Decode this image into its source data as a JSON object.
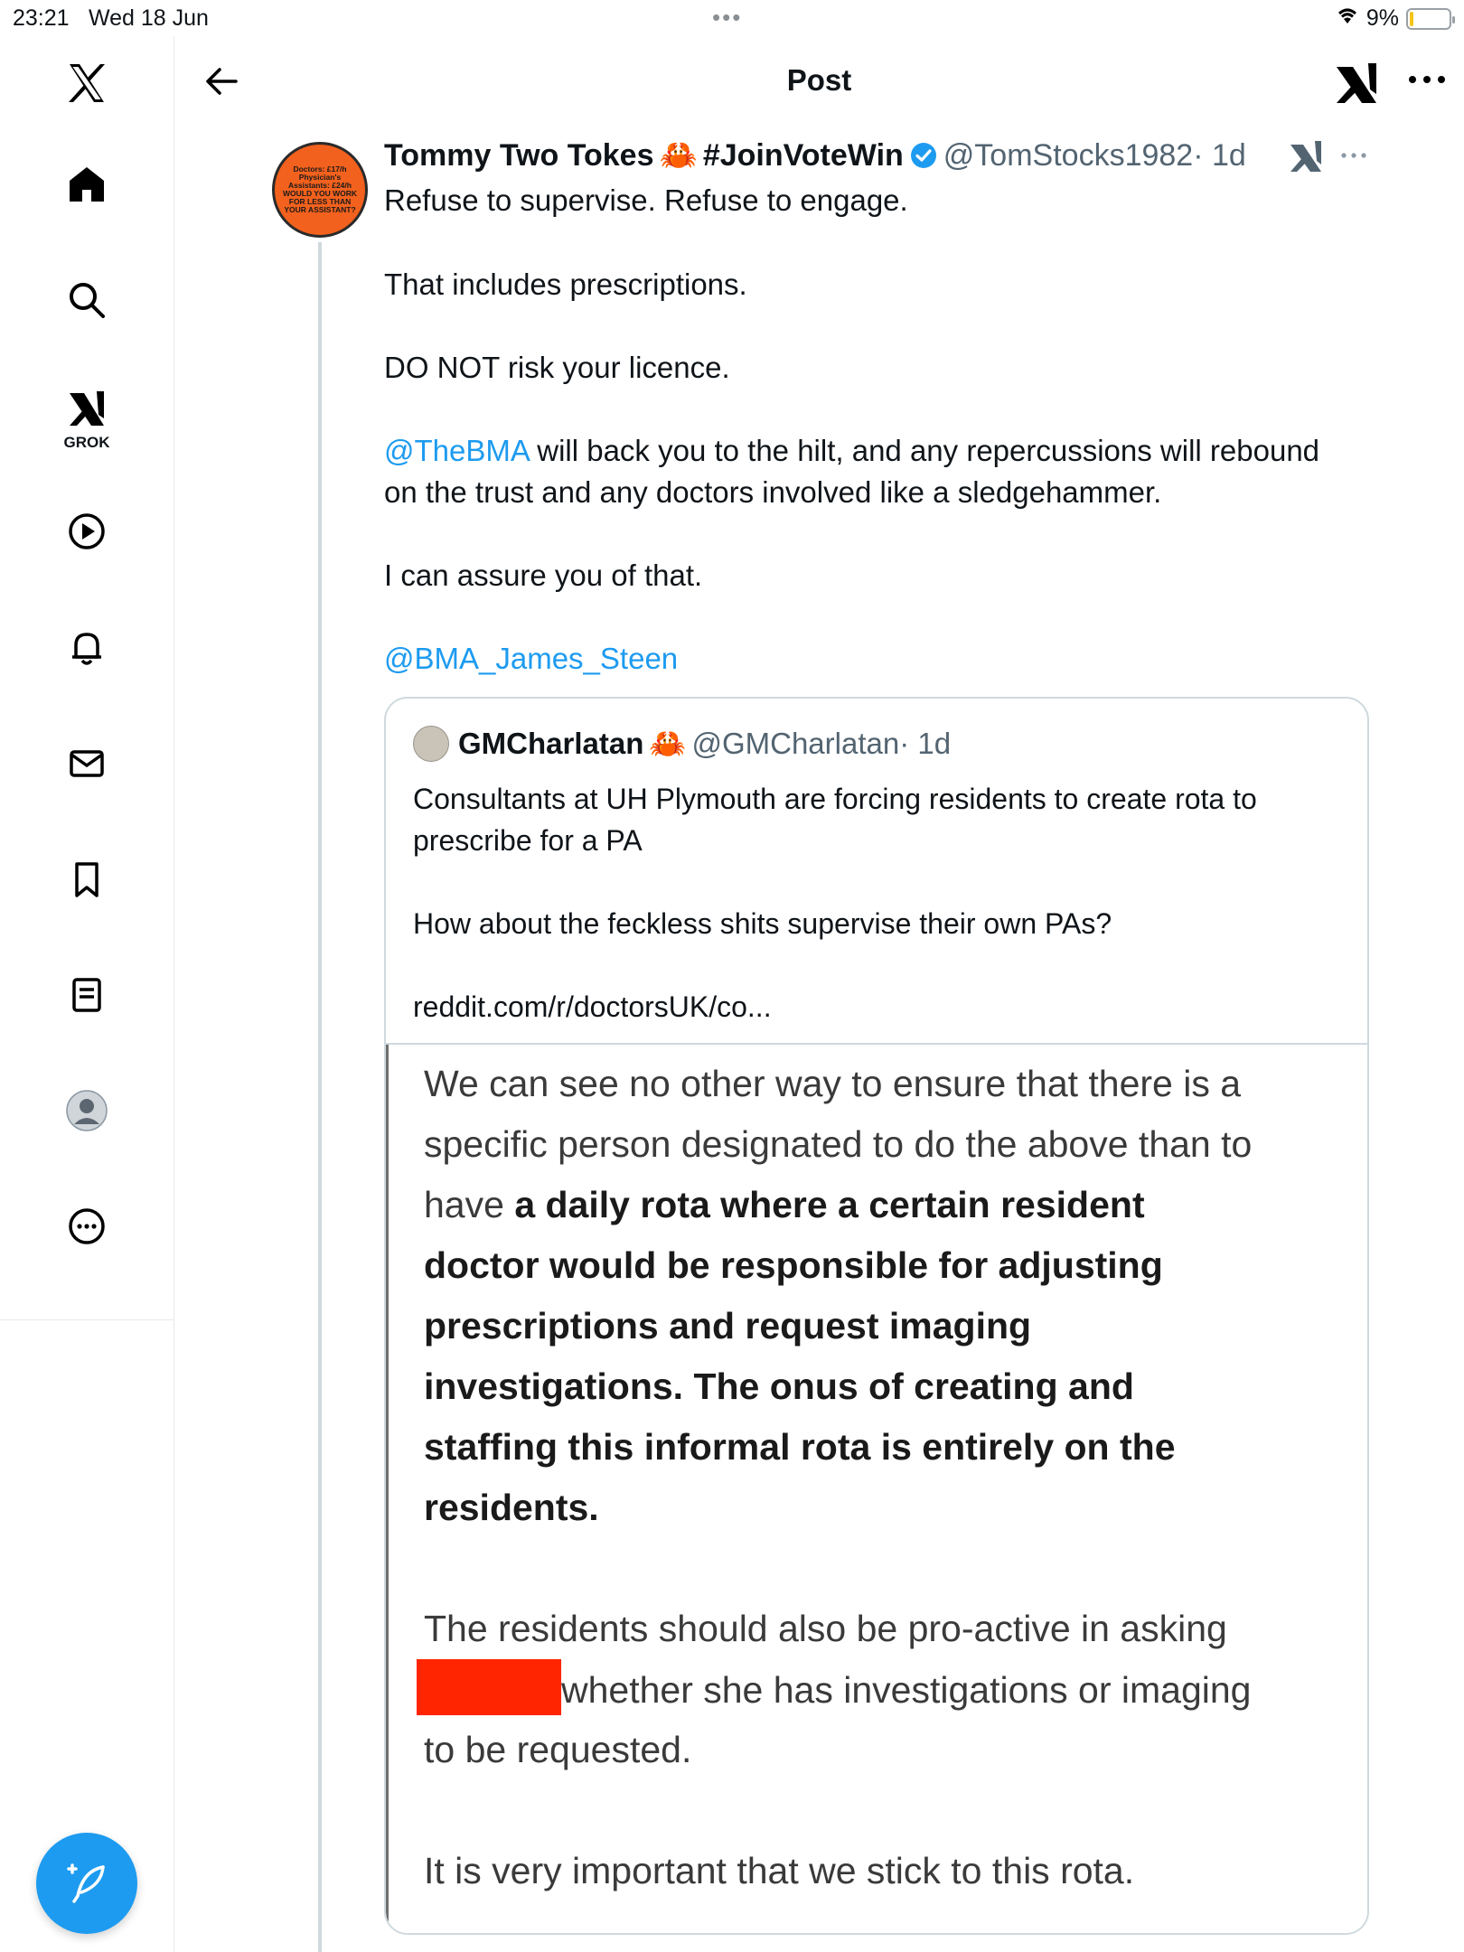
{
  "status_bar": {
    "time": "23:21",
    "date": "Wed 18 Jun",
    "battery": "9%",
    "battery_level": 0.09
  },
  "sidebar": {
    "grok_label": "GROK",
    "items": [
      "x-logo",
      "home",
      "search",
      "grok",
      "video",
      "notifications",
      "messages",
      "bookmarks",
      "lists",
      "profile",
      "more"
    ]
  },
  "header": {
    "title": "Post"
  },
  "post": {
    "avatar_text": "Doctors: £17/h Physician's Assistants: £24/h WOULD YOU WORK FOR LESS THAN YOUR ASSISTANT?",
    "author_name": "Tommy Two Tokes",
    "author_emoji": "🦀",
    "author_tag": "#JoinVoteWin",
    "handle": "@TomStocks1982",
    "time": "· 1d",
    "lines": {
      "l1": "Refuse to supervise. Refuse to engage.",
      "l2": "That includes prescriptions.",
      "l3": "DO NOT risk your licence.",
      "l4_mention": "@TheBMA",
      "l4_rest": " will back you to the hilt, and any repercussions will rebound",
      "l4_cont": "on the trust and any doctors involved like a sledgehammer.",
      "l5": "I can assure you of that.",
      "l6_mention": "@BMA_James_Steen"
    }
  },
  "quote": {
    "author_name": "GMCharlatan",
    "author_emoji": "🦀",
    "handle": "@GMCharlatan",
    "time": "· 1d",
    "line1": "Consultants at UH Plymouth are forcing residents to create rota to",
    "line2": "prescribe for a PA",
    "line3": "How about the feckless shits supervise their own PAs?",
    "link": "reddit.com/r/doctorsUK/co...",
    "document": {
      "p1_l1": "We can see no other way to ensure that there is a",
      "p1_l2": "specific person designated to do the above than to",
      "p1_l3_plain": "have ",
      "p1_l3_bold": "a daily rota where a certain resident",
      "p1_l4": "doctor would be responsible for adjusting",
      "p1_l5": "prescriptions and request imaging",
      "p1_l6": "investigations. The onus of creating and",
      "p1_l7": "staffing this informal rota is entirely on the",
      "p1_l8": "residents.",
      "p2_l1": "The residents should also be pro-active in asking",
      "p2_l2_after_redaction": "whether she has investigations or imaging",
      "p2_l3": "to be requested.",
      "p3_l1": "It is very important that we stick to this rota."
    }
  },
  "colors": {
    "accent": "#1d9bf0",
    "text": "#0f1419",
    "secondary": "#536471",
    "border": "#cfd9de",
    "redaction": "#ff2500",
    "battery": "#f5c518"
  }
}
